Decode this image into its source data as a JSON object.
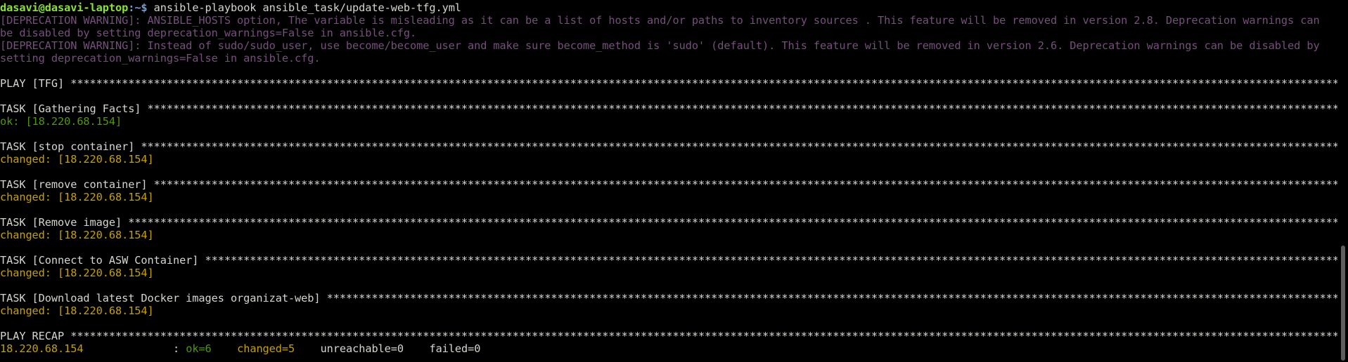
{
  "prompt": {
    "user_host": "dasavi@dasavi-laptop",
    "sep": ":~$",
    "command": " ansible-playbook ansible_task/update-web-tfg.yml"
  },
  "warnings": [
    "[DEPRECATION WARNING]: ANSIBLE_HOSTS option, The variable is misleading as it can be a list of hosts and/or paths to inventory sources . This feature will be removed in version 2.8. Deprecation warnings can be disabled by setting deprecation_warnings=False in ansible.cfg.",
    "[DEPRECATION WARNING]: Instead of sudo/sudo_user, use become/become_user and make sure become_method is 'sudo' (default). This feature will be removed in version 2.6. Deprecation warnings can be disabled by setting deprecation_warnings=False in ansible.cfg."
  ],
  "play": {
    "header": "PLAY [TFG] "
  },
  "tasks": [
    {
      "header": "TASK [Gathering Facts] ",
      "status": "ok: [18.220.68.154]",
      "kind": "ok"
    },
    {
      "header": "TASK [stop container] ",
      "status": "changed: [18.220.68.154]",
      "kind": "changed"
    },
    {
      "header": "TASK [remove container] ",
      "status": "changed: [18.220.68.154]",
      "kind": "changed"
    },
    {
      "header": "TASK [Remove image] ",
      "status": "changed: [18.220.68.154]",
      "kind": "changed"
    },
    {
      "header": "TASK [Connect to ASW Container] ",
      "status": "changed: [18.220.68.154]",
      "kind": "changed"
    },
    {
      "header": "TASK [Download latest Docker images organizat-web] ",
      "status": "changed: [18.220.68.154]",
      "kind": "changed"
    }
  ],
  "recap": {
    "header": "PLAY RECAP ",
    "host": "18.220.68.154",
    "sep": "              : ",
    "ok": "ok=6",
    "changed": "changed=5",
    "unreachable": "unreachable=0",
    "failed": "failed=0"
  },
  "colors": {
    "background": "#000000",
    "prompt_user": "#8ae234",
    "prompt_path": "#729fcf",
    "warning": "#75507b",
    "ok": "#4e9a06",
    "changed": "#c4a000",
    "text": "#d3d7cf"
  }
}
